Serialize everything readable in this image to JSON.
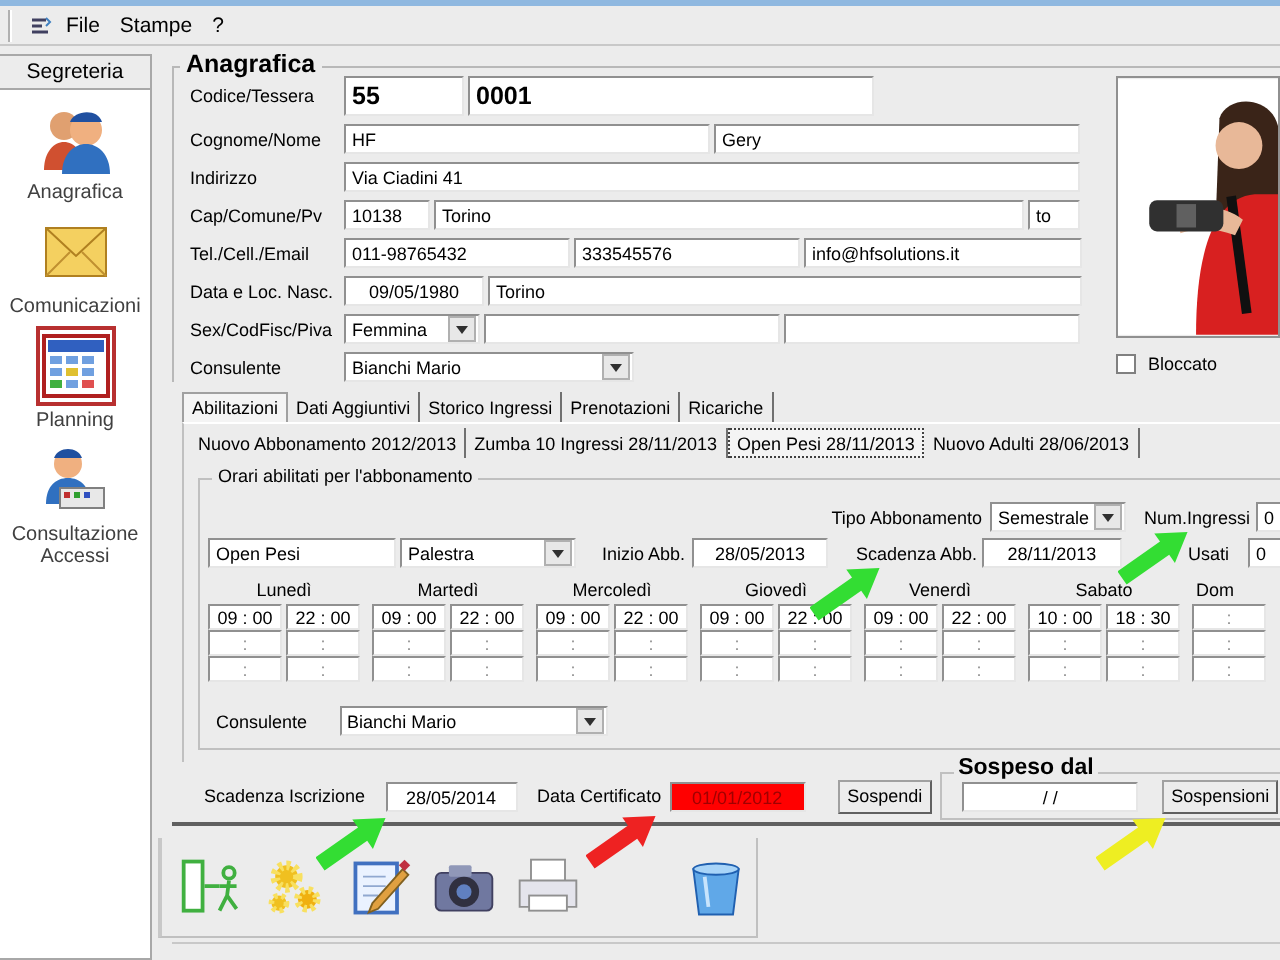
{
  "menu": [
    {
      "label": "File"
    },
    {
      "label": "Stampe"
    },
    {
      "label": "?"
    }
  ],
  "sidebar": {
    "header": "Segreteria",
    "items": [
      {
        "label": "Anagrafica",
        "kind": "people",
        "selected": false
      },
      {
        "label": "Comunicazioni",
        "kind": "envelope",
        "selected": false
      },
      {
        "label": "Planning",
        "kind": "calendar",
        "selected": true
      },
      {
        "label": "Consultazione Accessi",
        "kind": "clerk",
        "selected": false
      }
    ]
  },
  "anagrafica": {
    "title": "Anagrafica",
    "rows": [
      {
        "label": "Codice/Tessera",
        "fields": [
          {
            "kind": "bold",
            "value": "55"
          },
          {
            "kind": "bold",
            "value": "0001"
          }
        ]
      },
      {
        "label": "Cognome/Nome",
        "fields": [
          {
            "kind": "text",
            "value": "HF"
          },
          {
            "kind": "text",
            "value": "Gery"
          }
        ]
      },
      {
        "label": "Indirizzo",
        "fields": [
          {
            "kind": "text",
            "value": "Via Ciadini 41"
          }
        ]
      },
      {
        "label": "Cap/Comune/Pv",
        "fields": [
          {
            "kind": "text",
            "value": "10138"
          },
          {
            "kind": "text",
            "value": "Torino"
          },
          {
            "kind": "text",
            "value": "to"
          }
        ]
      },
      {
        "label": "Tel./Cell./Email",
        "fields": [
          {
            "kind": "text",
            "value": "011-98765432"
          },
          {
            "kind": "text",
            "value": "333545576"
          },
          {
            "kind": "text",
            "value": "info@hfsolutions.it"
          }
        ]
      },
      {
        "label": "Data e Loc. Nasc.",
        "fields": [
          {
            "kind": "center",
            "value": "09/05/1980"
          },
          {
            "kind": "text",
            "value": "Torino"
          }
        ]
      },
      {
        "label": "Sex/CodFisc/Piva",
        "fields": [
          {
            "kind": "select",
            "value": "Femmina"
          },
          {
            "kind": "text"
          },
          {
            "kind": "text"
          }
        ]
      },
      {
        "label": "Consulente",
        "fields": [
          {
            "kind": "select",
            "value": "Bianchi Mario"
          }
        ]
      }
    ],
    "blocked": {
      "label": "Bloccato",
      "checked": false
    }
  },
  "tabs": [
    {
      "label": "Abilitazioni",
      "selected": true
    },
    {
      "label": "Dati Aggiuntivi",
      "selected": false
    },
    {
      "label": "Storico Ingressi",
      "selected": false
    },
    {
      "label": "Prenotazioni",
      "selected": false
    },
    {
      "label": "Ricariche",
      "selected": false
    }
  ],
  "subtabs": [
    {
      "label": "Nuovo Abbonamento 2012/2013",
      "selected": false
    },
    {
      "label": "Zumba 10 Ingressi 28/11/2013",
      "selected": false
    },
    {
      "label": "Open Pesi 28/11/2013",
      "selected": true
    },
    {
      "label": "Nuovo Adulti 28/06/2013",
      "selected": false
    }
  ],
  "abbonamento": {
    "title": "Orari abilitati per l'abbonamento",
    "tipo_label": "Tipo Abbonamento",
    "tipo": "Semestrale",
    "num_ingressi_label": "Num.Ingressi",
    "num_ingressi": "0",
    "name": "Open Pesi",
    "area": "Palestra",
    "inizio_label": "Inizio Abb.",
    "inizio": "28/05/2013",
    "scadenza_label": "Scadenza Abb.",
    "scadenza": "28/11/2013",
    "usati_label": "Usati",
    "usati": "0",
    "days": [
      {
        "name": "Lunedì",
        "slots": [
          [
            "09 : 00",
            "22 : 00"
          ],
          [
            ":",
            ":"
          ],
          [
            ":",
            ":"
          ]
        ]
      },
      {
        "name": "Martedì",
        "slots": [
          [
            "09 : 00",
            "22 : 00"
          ],
          [
            ":",
            ":"
          ],
          [
            ":",
            ":"
          ]
        ]
      },
      {
        "name": "Mercoledì",
        "slots": [
          [
            "09 : 00",
            "22 : 00"
          ],
          [
            ":",
            ":"
          ],
          [
            ":",
            ":"
          ]
        ]
      },
      {
        "name": "Giovedì",
        "slots": [
          [
            "09 : 00",
            "22 : 00"
          ],
          [
            ":",
            ":"
          ],
          [
            ":",
            ":"
          ]
        ]
      },
      {
        "name": "Venerdì",
        "slots": [
          [
            "09 : 00",
            "22 : 00"
          ],
          [
            ":",
            ":"
          ],
          [
            ":",
            ":"
          ]
        ]
      },
      {
        "name": "Sabato",
        "slots": [
          [
            "10 : 00",
            "18 : 30"
          ],
          [
            ":",
            ":"
          ],
          [
            ":",
            ":"
          ]
        ]
      },
      {
        "name": "Dom",
        "slots": [
          [
            ":"
          ],
          [
            ":"
          ],
          [
            ":"
          ]
        ]
      }
    ],
    "consulente_label": "Consulente",
    "consulente": "Bianchi Mario"
  },
  "footer": {
    "iscrizione_label": "Scadenza Iscrizione",
    "iscrizione": "28/05/2014",
    "certificato_label": "Data Certificato",
    "certificato": {
      "value": "01/01/2012",
      "expired": true
    },
    "sospendi": "Sospendi",
    "sospeso_title": "Sospeso dal",
    "sospeso": "/   /",
    "sospensioni": "Sospensioni"
  },
  "toolbar": [
    {
      "kind": "exit"
    },
    {
      "kind": "gears"
    },
    {
      "kind": "edit"
    },
    {
      "kind": "camera"
    },
    {
      "kind": "printer"
    },
    {
      "kind": "bin"
    }
  ],
  "arrows": [
    {
      "color": "#33dd33"
    },
    {
      "color": "#33dd33"
    },
    {
      "color": "#33dd33"
    },
    {
      "color": "#ee2222"
    },
    {
      "color": "#eeee22"
    }
  ]
}
